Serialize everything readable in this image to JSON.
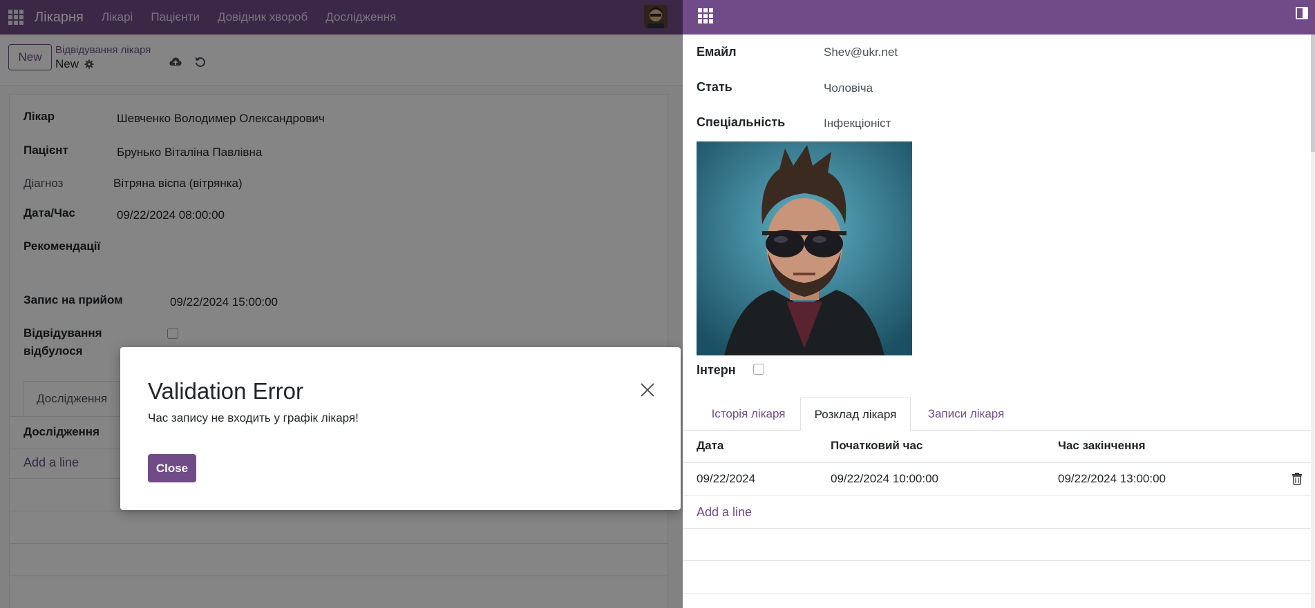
{
  "app": {
    "title": "Лікарня",
    "menu": [
      "Лікарі",
      "Пацієнти",
      "Довідник хвороб",
      "Дослідження"
    ]
  },
  "control_panel": {
    "new_label": "New",
    "breadcrumb": "Відвідування лікаря",
    "record_name": "New"
  },
  "form": {
    "doctor_label": "Лікар",
    "doctor_value": "Шевченко Володимер Олександрович",
    "patient_label": "Пацієнт",
    "patient_value": "Брунько Віталіна Павлівна",
    "diagnosis_label": "Діагноз",
    "diagnosis_value": "Вітряна віспа (вітрянка)",
    "datetime_label": "Дата/Час",
    "datetime_value": "09/22/2024 08:00:00",
    "recommendations_label": "Рекомендації",
    "appointment_label": "Запис на прийом",
    "appointment_value": "09/22/2024 15:00:00",
    "visit_done_label_1": "Відвідування",
    "visit_done_label_2": "відбулося",
    "visit_done_checked": false,
    "tab_research": "Дослідження",
    "list_header_research": "Дослідження",
    "add_line": "Add a line"
  },
  "modal": {
    "title": "Validation Error",
    "message": "Час запису не входить у графік лікаря!",
    "close_label": "Close"
  },
  "right": {
    "email_label": "Емайл",
    "email_value": "Shev@ukr.net",
    "gender_label": "Стать",
    "gender_value": "Чоловіча",
    "specialty_label": "Спеціальність",
    "specialty_value": "Інфекціоніст",
    "intern_label": "Інтерн",
    "intern_checked": false,
    "tabs": [
      "Історія лікаря",
      "Розклад лікаря",
      "Записи лікаря"
    ],
    "active_tab": "Розклад лікаря",
    "table": {
      "headers": [
        "Дата",
        "Початковий час",
        "Час закінчення"
      ],
      "rows": [
        [
          "09/22/2024",
          "09/22/2024 10:00:00",
          "09/22/2024 13:00:00"
        ]
      ]
    },
    "add_line": "Add a line"
  },
  "colors": {
    "brand": "#714b87",
    "overlay": "rgba(0,0,0,0.48)"
  }
}
